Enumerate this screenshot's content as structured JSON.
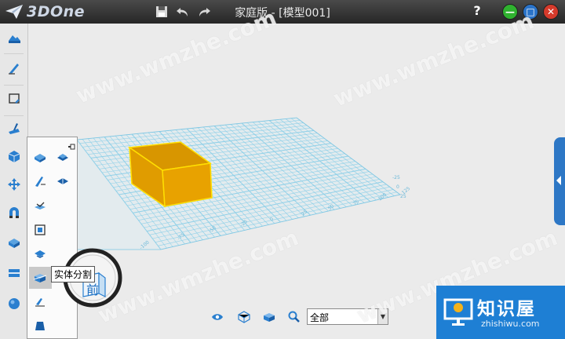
{
  "app": {
    "logo_text": "3DOne",
    "title": "家庭版 - [模型001]",
    "help": "?",
    "toolbar_icons": [
      "save-icon",
      "undo-icon",
      "redo-icon"
    ],
    "window_buttons": [
      {
        "name": "minimize-button",
        "glyph": "—",
        "color": "#2fb22f"
      },
      {
        "name": "maximize-button",
        "glyph": "□",
        "color": "#2a73c9"
      },
      {
        "name": "close-button",
        "glyph": "✕",
        "color": "#d53a2b"
      }
    ]
  },
  "sidebar": {
    "items": [
      "basic-shapes-icon",
      "sketch-icon",
      "sketch-edit-icon",
      "feature-modeling-icon",
      "special-feature-icon",
      "basic-edit-icon",
      "combine-edit-icon",
      "dimension-icon",
      "material-render-icon"
    ]
  },
  "flyout": {
    "pin_icon": "pin-icon",
    "tooltip": "实体分割",
    "items": [
      "move-icon",
      "delete-face-icon",
      "draft-face-icon",
      "split-face-icon",
      "wrap-icon",
      "emboss-icon",
      "offset-icon",
      "solid-split-icon",
      "blend-icon",
      "shell-icon"
    ]
  },
  "viewport": {
    "grid_x_labels": [
      "-100",
      "-75",
      "-50",
      "-25",
      "0",
      "25",
      "50",
      "75",
      "100",
      "125"
    ],
    "grid_y_labels": [
      "-25",
      "0",
      "25"
    ],
    "viewcube_label": "前",
    "colors": {
      "grid": "#8fd0e8",
      "box_face": "#e8a200",
      "box_dark": "#c98800",
      "box_edge": "#ffdf00"
    }
  },
  "bottom_toolbar": {
    "icons": [
      "view-icon",
      "render-mode-icon",
      "display-icon",
      "search-icon"
    ],
    "filter_value": "全部"
  },
  "watermarks": [
    "www.wmzhe.com"
  ],
  "badge": {
    "brand": "知识屋",
    "url": "zhishiwu.com"
  }
}
